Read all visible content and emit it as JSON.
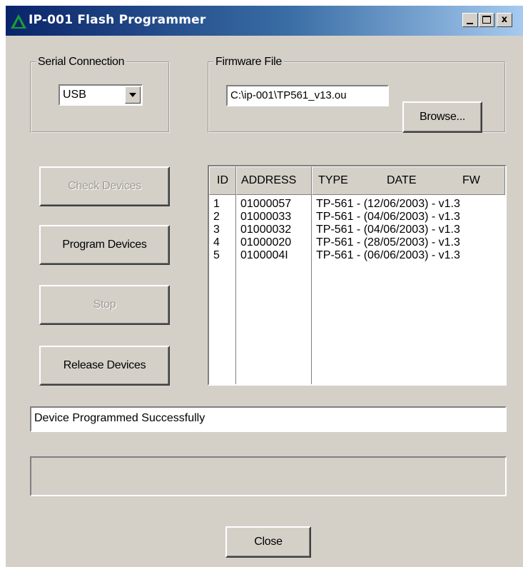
{
  "window": {
    "title": "IP-001 Flash Programmer",
    "buttons": {
      "minimize": "_",
      "maximize": "□",
      "close": "x"
    }
  },
  "serial_connection": {
    "legend": "Serial Connection",
    "selected": "USB"
  },
  "firmware_file": {
    "legend": "Firmware File",
    "path": "C:\\ip-001\\TP561_v13.ou",
    "browse_label": "Browse..."
  },
  "actions": {
    "check_devices": {
      "label": "Check Devices",
      "enabled": false
    },
    "program_devices": {
      "label": "Program Devices",
      "enabled": true
    },
    "stop": {
      "label": "Stop",
      "enabled": false
    },
    "release_devices": {
      "label": "Release Devices",
      "enabled": true
    }
  },
  "device_list": {
    "headers": {
      "id": "ID",
      "address": "ADDRESS",
      "type": "TYPE",
      "date": "DATE",
      "fw": "FW"
    },
    "rows": [
      {
        "id": "1",
        "address": "01000057",
        "info": "TP-561 - (12/06/2003) - v1.3"
      },
      {
        "id": "2",
        "address": "01000033",
        "info": "TP-561 - (04/06/2003) - v1.3"
      },
      {
        "id": "3",
        "address": "01000032",
        "info": "TP-561 - (04/06/2003) - v1.3"
      },
      {
        "id": "4",
        "address": "01000020",
        "info": "TP-561 - (28/05/2003) - v1.3"
      },
      {
        "id": "5",
        "address": "0100004I",
        "info": "TP-561 - (06/06/2003) - v1.3"
      }
    ]
  },
  "status": {
    "message": "Device Programmed Successfully"
  },
  "progress": {
    "value": 0
  },
  "footer": {
    "close_label": "Close"
  },
  "colors": {
    "title_gradient_start": "#0a246a",
    "title_gradient_end": "#a6caf0",
    "face": "#d4d0c8",
    "icon_green": "#1a9c3a"
  }
}
